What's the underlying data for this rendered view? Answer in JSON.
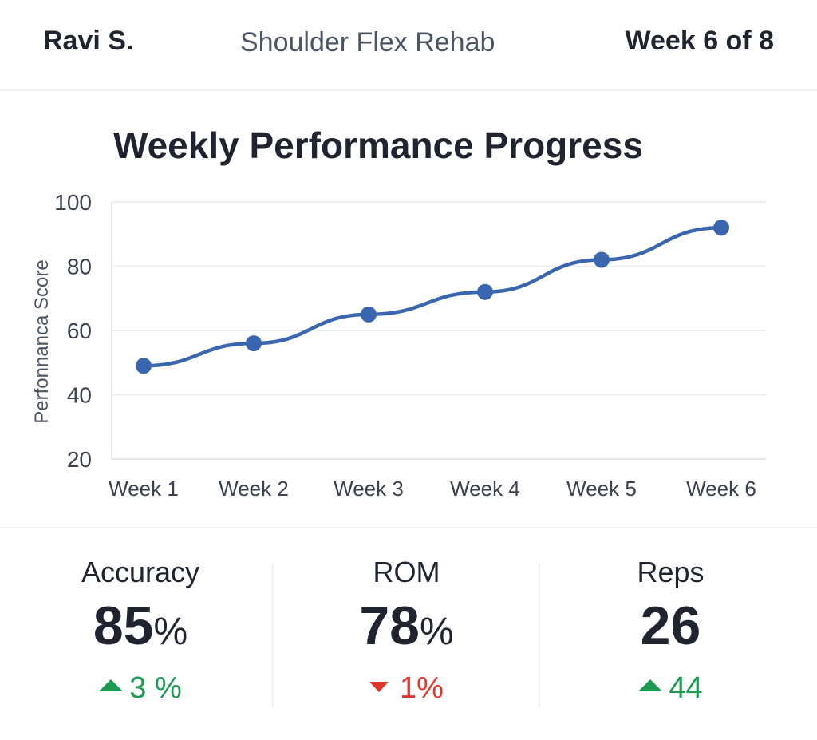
{
  "header": {
    "patient_name": "Ravi S.",
    "program_name": "Shoulder Flex Rehab",
    "week_label": "Week 6 of 8"
  },
  "chart_data": {
    "type": "line",
    "title": "Weekly Performance Progress",
    "xlabel": "",
    "ylabel": "Perfonnanca Score",
    "categories": [
      "Week 1",
      "Week 2",
      "Week 3",
      "Week 4",
      "Week 5",
      "Week 6"
    ],
    "series": [
      {
        "values": [
          49,
          56,
          65,
          72,
          82,
          92
        ]
      }
    ],
    "ylim": [
      20,
      100
    ],
    "yticks": [
      20,
      40,
      60,
      80,
      100
    ],
    "grid": true,
    "line_color": "#3a66b0"
  },
  "stats": [
    {
      "label": "Accuracy",
      "value": "85",
      "unit": "%",
      "change": "3 %",
      "direction": "up"
    },
    {
      "label": "ROM",
      "value": "78",
      "unit": "%",
      "change": "1%",
      "direction": "down"
    },
    {
      "label": "Reps",
      "value": "26",
      "unit": "",
      "change": "44",
      "direction": "up"
    }
  ],
  "colors": {
    "up": "#1c9a50",
    "down": "#e0352b",
    "text": "#1f2430"
  }
}
